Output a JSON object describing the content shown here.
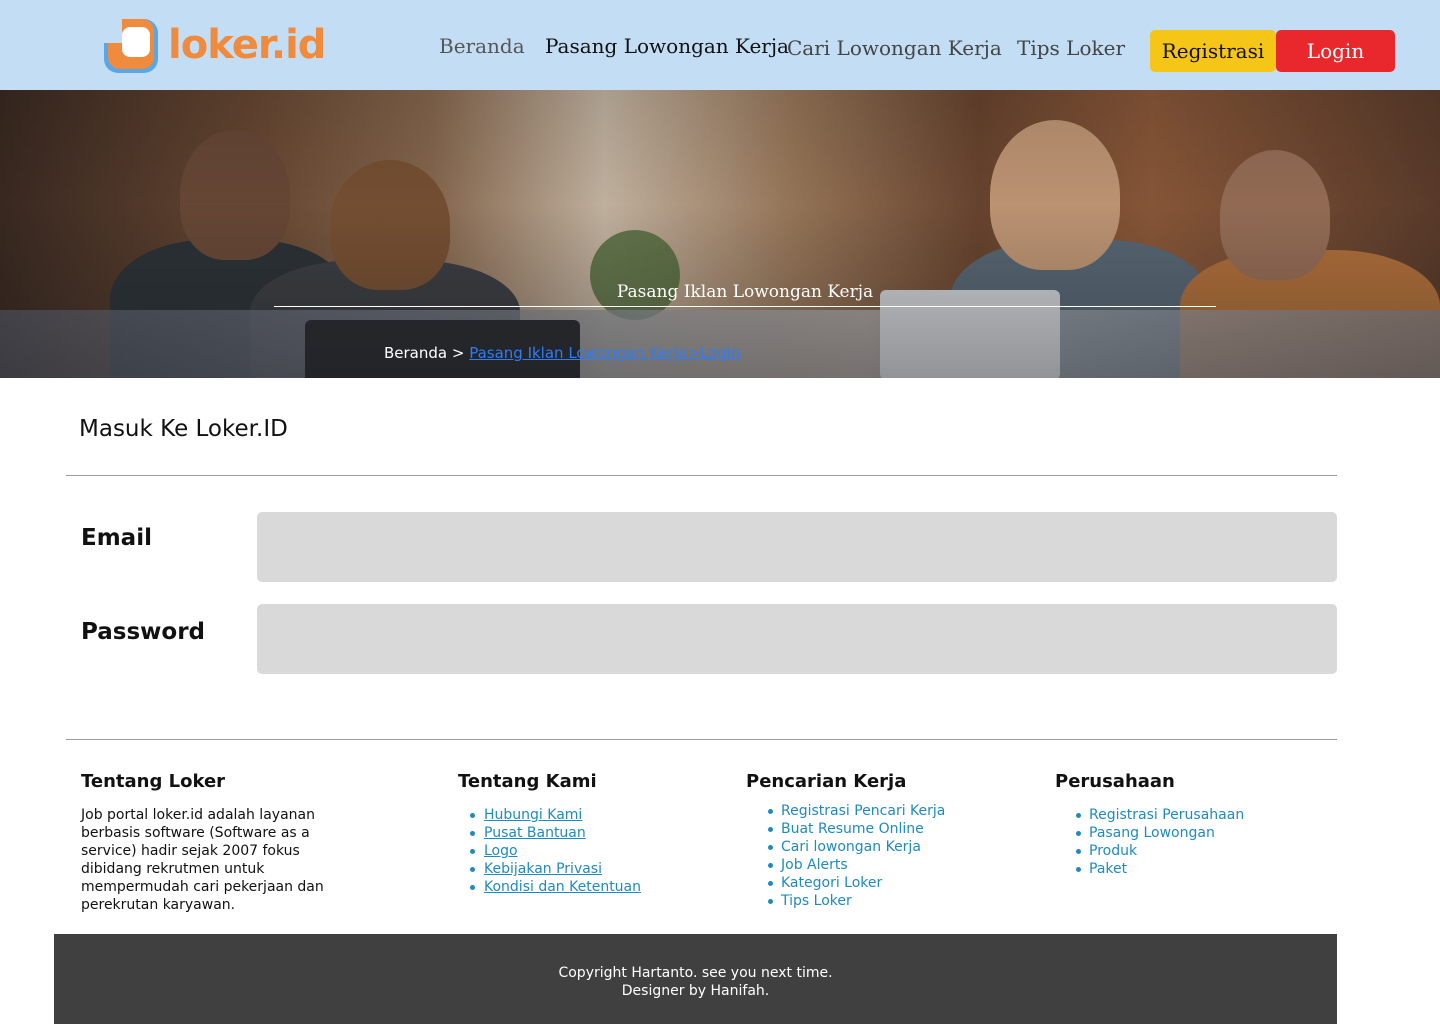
{
  "header": {
    "logo_text": "loker.id",
    "nav": {
      "beranda": "Beranda",
      "pasang": "Pasang Lowongan Kerja",
      "cari": "Cari Lowongan Kerja",
      "tips": "Tips Loker"
    },
    "register_label": "Registrasi",
    "login_label": "Login"
  },
  "hero": {
    "title": "Pasang Iklan Lowongan Kerja",
    "breadcrumb_home": "Beranda > ",
    "breadcrumb_link": "Pasang Iklan Lowongan Kerja>Login"
  },
  "login": {
    "title": "Masuk Ke Loker.ID",
    "email_label": "Email",
    "email_value": "",
    "password_label": "Password",
    "password_value": ""
  },
  "footer": {
    "about": {
      "title": "Tentang Loker",
      "text": "Job portal loker.id adalah layanan  berbasis software (Software as a service) hadir sejak 2007 fokus dibidang rekrutmen untuk mempermudah cari pekerjaan dan perekrutan karyawan."
    },
    "about_us": {
      "title": "Tentang Kami",
      "items": [
        "Hubungi Kami",
        "Pusat Bantuan",
        "Logo",
        "Kebijakan Privasi",
        "Kondisi dan Ketentuan"
      ]
    },
    "job_search": {
      "title": "Pencarian Kerja",
      "items": [
        "Registrasi Pencari Kerja",
        "Buat Resume Online",
        "Cari lowongan Kerja",
        "Job Alerts",
        "Kategori Loker",
        "Tips Loker"
      ]
    },
    "company": {
      "title": "Perusahaan",
      "items": [
        "Registrasi Perusahaan",
        "Pasang Lowongan",
        "Produk",
        "Paket"
      ]
    },
    "copyright_line1": "Copyright Hartanto. see you next time.",
    "copyright_line2": "Designer by Hanifah."
  },
  "colors": {
    "header_bg": "#c3def4",
    "logo_orange": "#f08a3c",
    "register_bg": "#f5c518",
    "login_bg": "#e8282d",
    "link_blue": "#1f8ac0",
    "footer_bar": "#404040"
  }
}
